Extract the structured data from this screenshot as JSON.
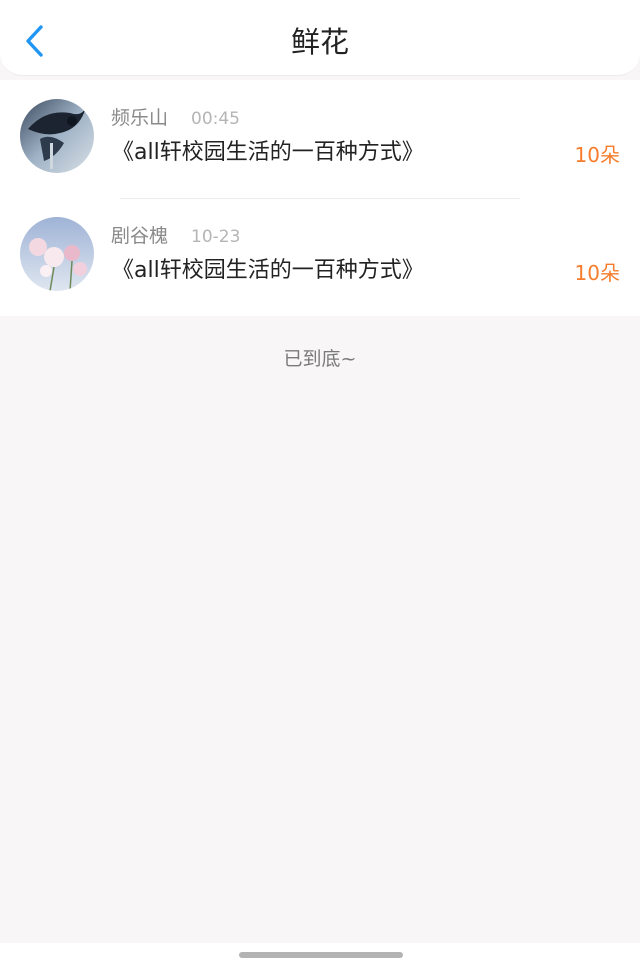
{
  "header": {
    "title": "鲜花",
    "back_icon": "chevron-left-icon",
    "accent_color": "#2196f3"
  },
  "items": [
    {
      "name": "频乐山",
      "time": "00:45",
      "book": "《all轩校园生活的一百种方式》",
      "count": "10朵",
      "avatar": "dark-bird-photo"
    },
    {
      "name": "剧谷槐",
      "time": "10-23",
      "book": "《all轩校园生活的一百种方式》",
      "count": "10朵",
      "avatar": "pink-flowers-photo"
    }
  ],
  "footer": {
    "end_text": "已到底~"
  },
  "colors": {
    "count": "#f57d2c",
    "name": "#8a8a8a",
    "time": "#b5b5b5"
  }
}
